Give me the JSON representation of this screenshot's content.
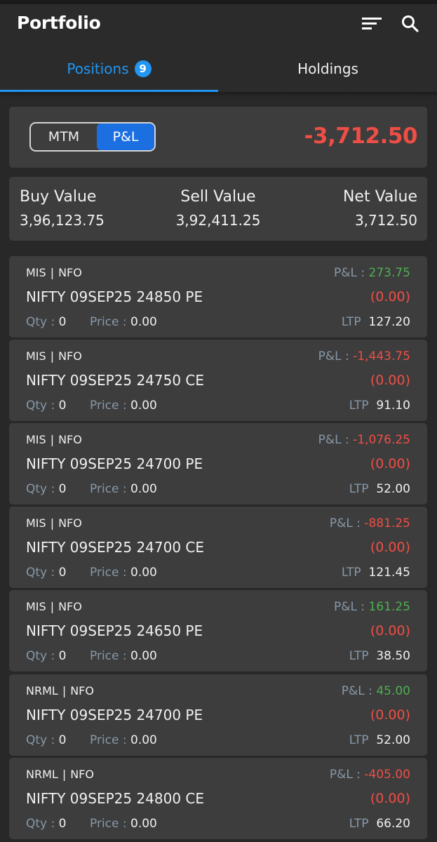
{
  "header": {
    "title": "Portfolio",
    "icons": [
      "sort-icon",
      "search-icon"
    ]
  },
  "tabs": [
    {
      "label": "Positions",
      "badge": "9",
      "active": true
    },
    {
      "label": "Holdings",
      "active": false
    }
  ],
  "pnl_toggle": {
    "options": [
      "MTM",
      "P&L"
    ],
    "selected": "P&L",
    "total": "-3,712.50"
  },
  "values": [
    {
      "label": "Buy Value",
      "value": "3,96,123.75"
    },
    {
      "label": "Sell Value",
      "value": "3,92,411.25"
    },
    {
      "label": "Net Value",
      "value": "3,712.50"
    }
  ],
  "positions": [
    {
      "product": "MIS",
      "exchange": "NFO",
      "symbol": "NIFTY 09SEP25 24850 PE",
      "pnl": "273.75",
      "pnl_positive": true,
      "change": "(0.00)",
      "qty": "0",
      "price": "0.00",
      "ltp": "127.20"
    },
    {
      "product": "MIS",
      "exchange": "NFO",
      "symbol": "NIFTY 09SEP25 24750 CE",
      "pnl": "-1,443.75",
      "pnl_positive": false,
      "change": "(0.00)",
      "qty": "0",
      "price": "0.00",
      "ltp": "91.10"
    },
    {
      "product": "MIS",
      "exchange": "NFO",
      "symbol": "NIFTY 09SEP25 24700 PE",
      "pnl": "-1,076.25",
      "pnl_positive": false,
      "change": "(0.00)",
      "qty": "0",
      "price": "0.00",
      "ltp": "52.00"
    },
    {
      "product": "MIS",
      "exchange": "NFO",
      "symbol": "NIFTY 09SEP25 24700 CE",
      "pnl": "-881.25",
      "pnl_positive": false,
      "change": "(0.00)",
      "qty": "0",
      "price": "0.00",
      "ltp": "121.45"
    },
    {
      "product": "MIS",
      "exchange": "NFO",
      "symbol": "NIFTY 09SEP25 24650 PE",
      "pnl": "161.25",
      "pnl_positive": true,
      "change": "(0.00)",
      "qty": "0",
      "price": "0.00",
      "ltp": "38.50"
    },
    {
      "product": "NRML",
      "exchange": "NFO",
      "symbol": "NIFTY 09SEP25 24700 PE",
      "pnl": "45.00",
      "pnl_positive": true,
      "change": "(0.00)",
      "qty": "0",
      "price": "0.00",
      "ltp": "52.00"
    },
    {
      "product": "NRML",
      "exchange": "NFO",
      "symbol": "NIFTY 09SEP25 24800 CE",
      "pnl": "-405.00",
      "pnl_positive": false,
      "change": "(0.00)",
      "qty": "0",
      "price": "0.00",
      "ltp": "66.20"
    }
  ],
  "labels": {
    "pnl": "P&L :",
    "qty": "Qty :",
    "price": "Price :",
    "ltp": "LTP",
    "separator": "|"
  },
  "colors": {
    "accent": "#2196f3",
    "profit": "#4caf50",
    "loss": "#ef4e45",
    "toggle_selected": "#1c6fe0"
  }
}
